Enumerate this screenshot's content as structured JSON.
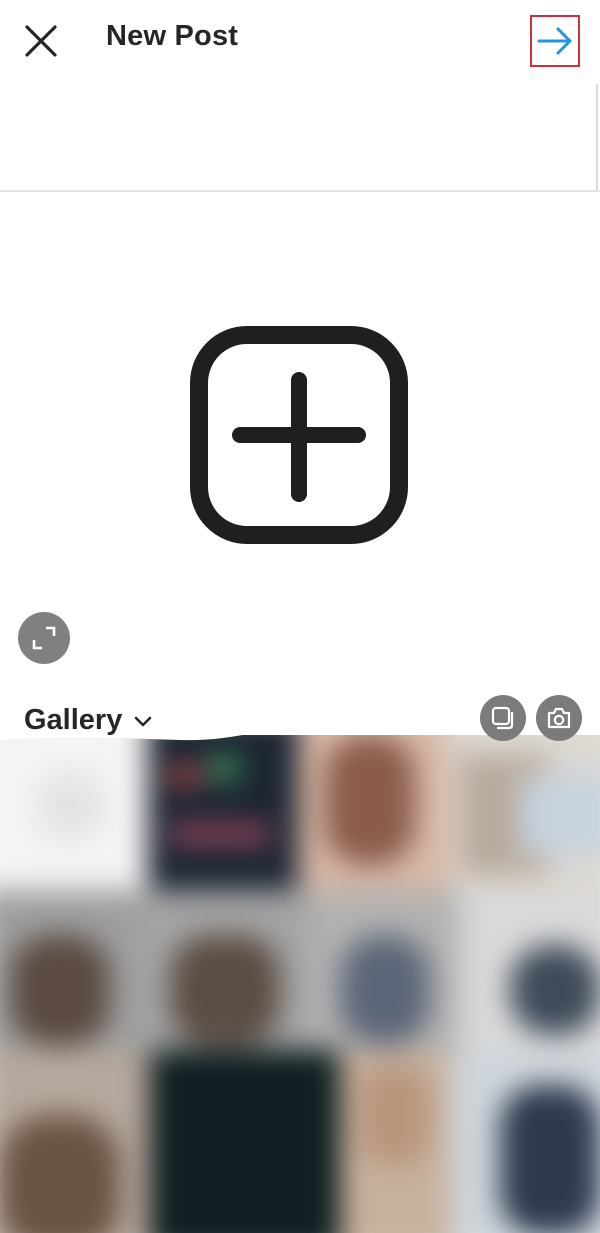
{
  "header": {
    "title": "New Post",
    "close_icon": "close-icon",
    "next_icon": "arrow-right-icon",
    "next_color": "#2196d9",
    "highlight_color": "#d32f3a"
  },
  "preview": {
    "placeholder_icon": "add-square-icon",
    "expand_icon": "expand-icon"
  },
  "gallery": {
    "selector_label": "Gallery",
    "dropdown_icon": "chevron-down-icon",
    "multi_select_icon": "multi-select-icon",
    "camera_icon": "camera-icon"
  }
}
